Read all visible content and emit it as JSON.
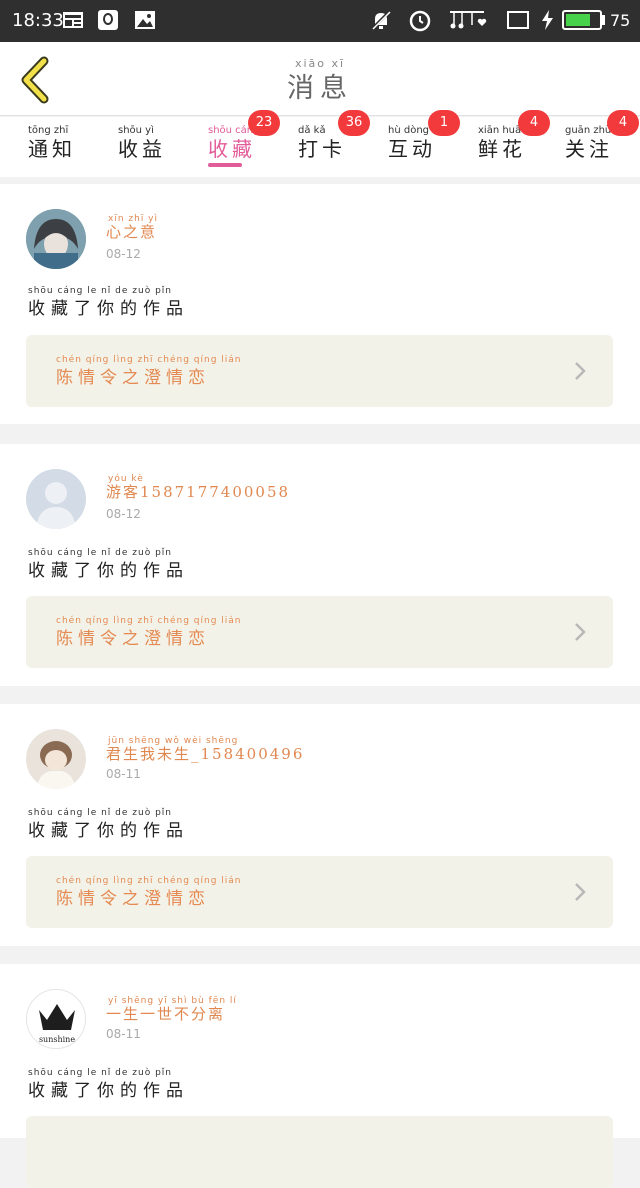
{
  "status_bar": {
    "time": "18:33",
    "battery_percent": "75",
    "battery_level": 0.75,
    "icons": [
      "news-icon",
      "chat-icon",
      "image-icon",
      "mute-icon",
      "alarm-icon",
      "music-icon",
      "tablet-icon",
      "charging-icon",
      "battery-icon"
    ]
  },
  "header": {
    "title_pinyin": "xiāo xī",
    "title": "消息",
    "back_icon": "chevron-left-icon"
  },
  "tabs": [
    {
      "pinyin": "tōng zhī",
      "label": "通知",
      "badge": ""
    },
    {
      "pinyin": "shōu yì",
      "label": "收益",
      "badge": ""
    },
    {
      "pinyin": "shōu cáng",
      "label": "收藏",
      "badge": "23",
      "active": true
    },
    {
      "pinyin": "dǎ kǎ",
      "label": "打卡",
      "badge": "36"
    },
    {
      "pinyin": "hù dòng",
      "label": "互动",
      "badge": "1"
    },
    {
      "pinyin": "xiān huā",
      "label": "鲜花",
      "badge": "4"
    },
    {
      "pinyin": "guān zhù",
      "label": "关注",
      "badge": "4"
    }
  ],
  "colors": {
    "accent": "#e25c99",
    "badge": "#f2393c",
    "name": "#e08850",
    "work_bg": "#f3f2e8"
  },
  "notifications": [
    {
      "name_pinyin": "xīn zhī yì",
      "name": "心之意",
      "date": "08-12",
      "action_pinyin": "shōu cáng le nǐ de zuò pǐn",
      "action": "收藏了你的作品",
      "work_pinyin": "chén qíng lìng zhī chéng qíng lián",
      "work_title": "陈情令之澄情恋",
      "avatar": "anime-girl-avatar"
    },
    {
      "name_pinyin": "yóu kè",
      "name": "游客1587177400058",
      "date": "08-12",
      "action_pinyin": "shōu cáng le nǐ de zuò pǐn",
      "action": "收藏了你的作品",
      "work_pinyin": "chén qíng lìng zhī chéng qíng lián",
      "work_title": "陈情令之澄情恋",
      "avatar": "default-user-avatar"
    },
    {
      "name_pinyin": "jūn shēng wǒ wèi shēng",
      "name": "君生我未生_158400496",
      "date": "08-11",
      "action_pinyin": "shōu cáng le nǐ de zuò pǐn",
      "action": "收藏了你的作品",
      "work_pinyin": "chén qíng lìng zhī chéng qíng lián",
      "work_title": "陈情令之澄情恋",
      "avatar": "child-photo-avatar"
    },
    {
      "name_pinyin": "yī shēng yī shì bù fēn lí",
      "name": "一生一世不分离",
      "date": "08-11",
      "action_pinyin": "shōu cáng le nǐ de zuò pǐn",
      "action": "收藏了你的作品",
      "work_pinyin": "",
      "work_title": "",
      "avatar": "crown-sunshine-avatar",
      "avatar_text": "sunshine"
    }
  ]
}
